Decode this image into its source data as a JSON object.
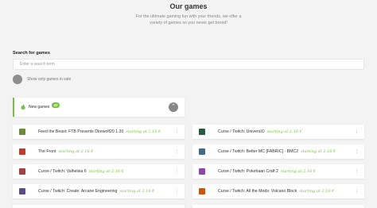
{
  "header": {
    "title": "Our games",
    "subtitle": "For the ultimate gaming fun with your friends, we offer a variety of games so you never get bored!"
  },
  "search": {
    "label": "Search for games",
    "placeholder": "Enter a search term",
    "sale_toggle_label": "Show only games in sale"
  },
  "category": {
    "label": "New games",
    "count": "42",
    "collapse_icon": "chevron-up-icon"
  },
  "games": [
    {
      "name": "Feed the Beast: FTB Presents Direwolf20 1.20",
      "price": "starting at 2,16 €",
      "thumb_color": "#6d8a3a"
    },
    {
      "name": "Curse / Twitch: UniversIO",
      "price": "starting at 2,16 €",
      "thumb_color": "#2a5a3e"
    },
    {
      "name": "The Front",
      "price": "starting at 2,16 €",
      "thumb_color": "#c0392b"
    },
    {
      "name": "Curse / Twitch: Better MC [FABRIC] - BMC2",
      "price": "starting at 2,16 €",
      "thumb_color": "#3f6b8c"
    },
    {
      "name": "Curse / Twitch: Valhelsia 6",
      "price": "starting at 2,16 €",
      "thumb_color": "#a04040"
    },
    {
      "name": "Curse / Twitch: Pokehaan Craft 2",
      "price": "starting at 2,16 €",
      "thumb_color": "#8e44ad"
    },
    {
      "name": "Curse / Twitch: Create: Arcane Engineering",
      "price": "starting at 2,16 €",
      "thumb_color": "#5d4a8a"
    },
    {
      "name": "Curse / Twitch: All the Mods: Volcano Block",
      "price": "starting at 2,16 €",
      "thumb_color": "#d35400"
    }
  ],
  "game_menu_icon": "more-vertical-icon",
  "fire_icon_color": "#7bc043",
  "accent_color": "#7bc043"
}
